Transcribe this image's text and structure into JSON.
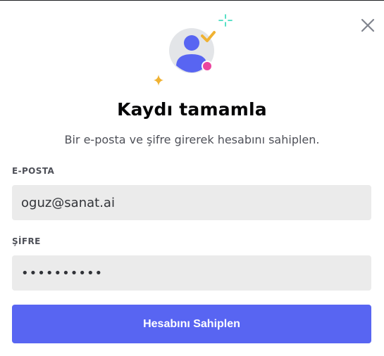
{
  "modal": {
    "title": "Kaydı tamamla",
    "subtitle": "Bir e-posta ve şifre girerek hesabını sahiplen."
  },
  "form": {
    "email_label": "E-POSTA",
    "email_value": "oguz@sanat.ai",
    "password_label": "ŞİFRE",
    "password_value": "••••••••••",
    "submit_label": "Hesabını Sahiplen"
  },
  "icons": {
    "close": "close-icon",
    "hero": "user-avatar-illustration"
  },
  "colors": {
    "accent": "#5865f2",
    "avatar_bg": "#e3e5e8",
    "avatar_figure": "#5865f2",
    "check": "#f0b232",
    "status_dot": "#eb459f",
    "sparkle_yellow": "#f0b232",
    "sparkle_cyan": "#45ddc0"
  }
}
